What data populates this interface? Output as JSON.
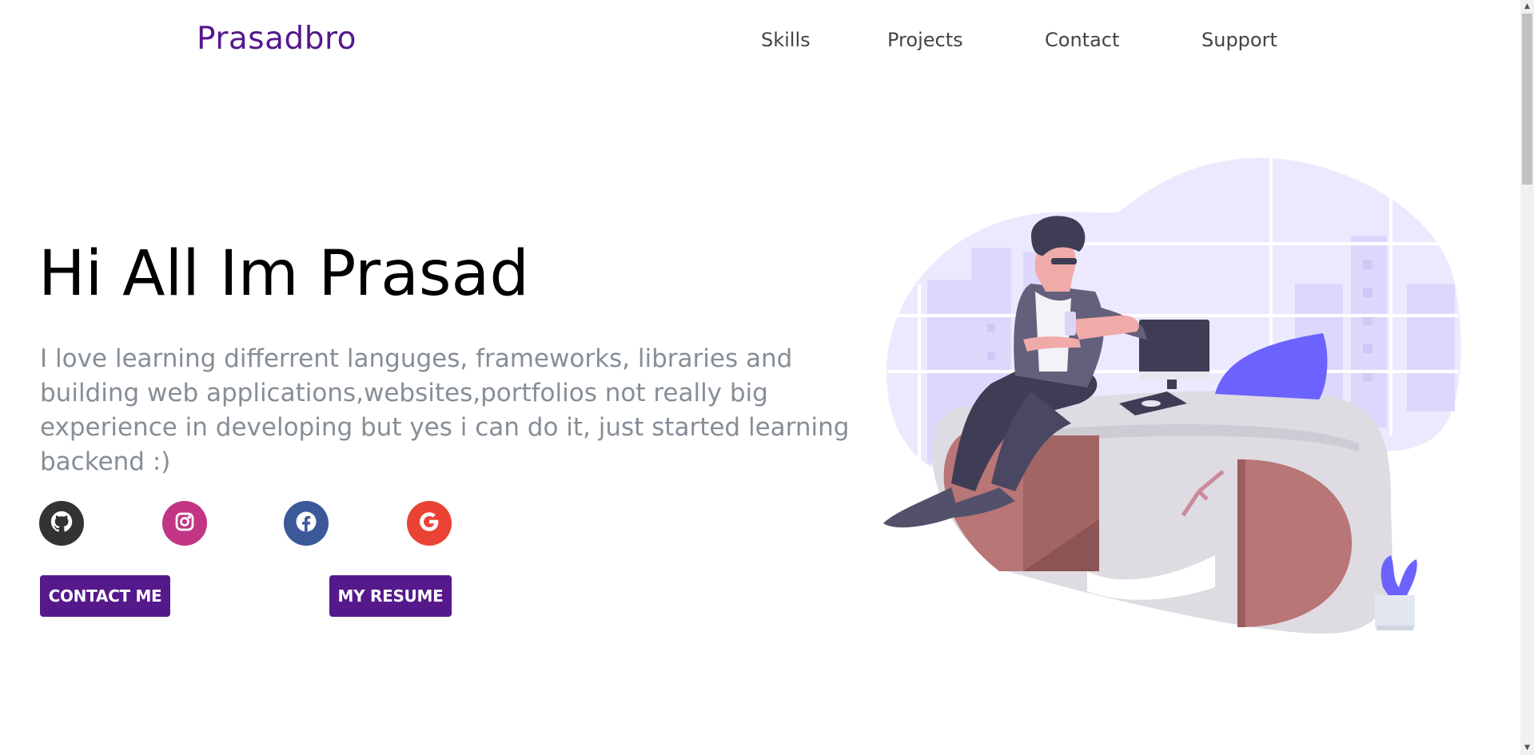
{
  "header": {
    "logo": "Prasadbro",
    "nav": [
      {
        "label": "Skills"
      },
      {
        "label": "Projects"
      },
      {
        "label": "Contact"
      },
      {
        "label": "Support"
      }
    ]
  },
  "hero": {
    "title": "Hi All Im Prasad",
    "subtitle": "I love learning differrent languges, frameworks, libraries and building web applications,websites,portfolios not really big experience in developing but yes i can do it, just started learning backend :)",
    "social": [
      {
        "icon": "github-icon",
        "color": "#333333"
      },
      {
        "icon": "instagram-icon",
        "color": "#c13584"
      },
      {
        "icon": "facebook-icon",
        "color": "#3b5998"
      },
      {
        "icon": "google-icon",
        "color": "#ea4335"
      }
    ],
    "buttons": {
      "contact": "CONTACT ME",
      "resume": "MY RESUME"
    }
  },
  "colors": {
    "accent": "#55198b",
    "subtitle": "#868e96",
    "illustration_primary": "#6c63ff",
    "desk_red": "#b87676"
  }
}
